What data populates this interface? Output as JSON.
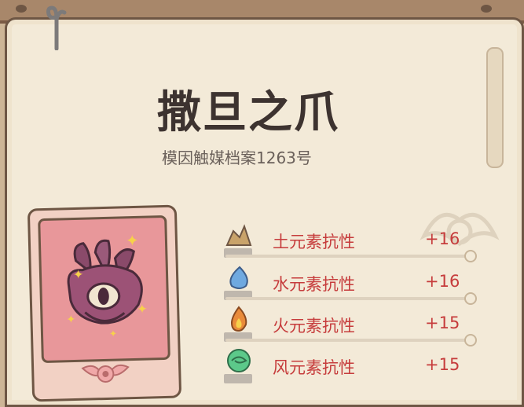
{
  "item": {
    "name": "撒旦之爪",
    "archive": "模因触媒档案1263号"
  },
  "stats": [
    {
      "label": "土元素抗性",
      "value": "+16",
      "icon": "earth-element-icon",
      "color": "#c9a36a"
    },
    {
      "label": "水元素抗性",
      "value": "+16",
      "icon": "water-element-icon",
      "color": "#6fa9e0"
    },
    {
      "label": "火元素抗性",
      "value": "+15",
      "icon": "fire-element-icon",
      "color": "#e98b3a"
    },
    {
      "label": "风元素抗性",
      "value": "+15",
      "icon": "wind-element-icon",
      "color": "#5cc98a"
    }
  ],
  "colors": {
    "frame": "#6e5644",
    "parchment": "#f3ead8",
    "stat_text": "#c63c3c",
    "card_bg": "#e8979a"
  }
}
